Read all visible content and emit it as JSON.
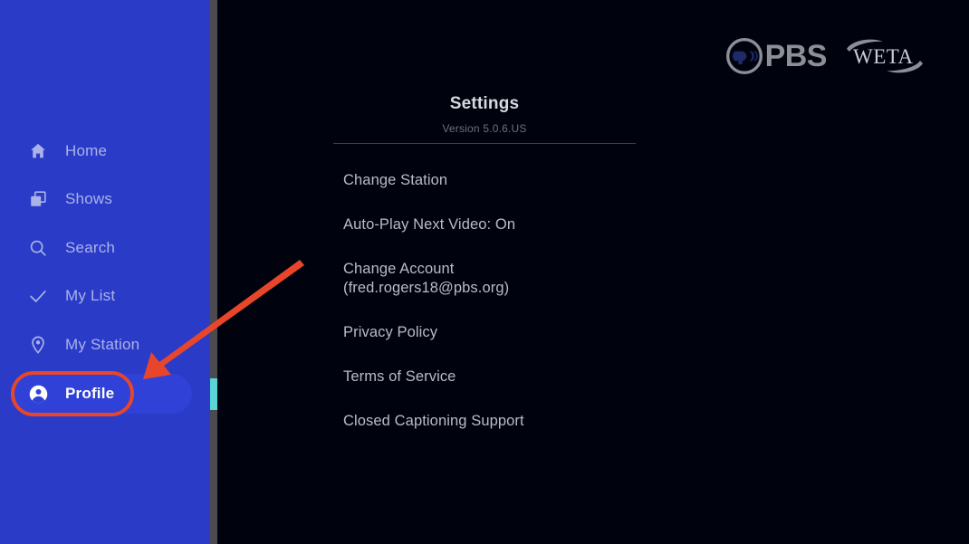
{
  "app": {
    "background_color": "#00020e",
    "sidebar_color": "#2a3bc8",
    "accent_teal": "#5ad5d5",
    "annotation_color": "#e8462a"
  },
  "sidebar": {
    "items": [
      {
        "label": "Home",
        "icon": "home-icon",
        "selected": false
      },
      {
        "label": "Shows",
        "icon": "shows-icon",
        "selected": false
      },
      {
        "label": "Search",
        "icon": "search-icon",
        "selected": false
      },
      {
        "label": "My List",
        "icon": "check-icon",
        "selected": false
      },
      {
        "label": "My Station",
        "icon": "pin-icon",
        "selected": false
      },
      {
        "label": "Profile",
        "icon": "profile-icon",
        "selected": true
      }
    ]
  },
  "brand": {
    "pbs_wordmark": "PBS",
    "station_wordmark": "WETA"
  },
  "settings": {
    "title": "Settings",
    "version": "Version 5.0.6.US",
    "items": [
      {
        "label": "Change Station"
      },
      {
        "label": "Auto-Play Next Video: On"
      },
      {
        "label": "Change Account\n(fred.rogers18@pbs.org)"
      },
      {
        "label": "Privacy Policy"
      },
      {
        "label": "Terms of Service"
      },
      {
        "label": "Closed Captioning Support"
      }
    ]
  }
}
